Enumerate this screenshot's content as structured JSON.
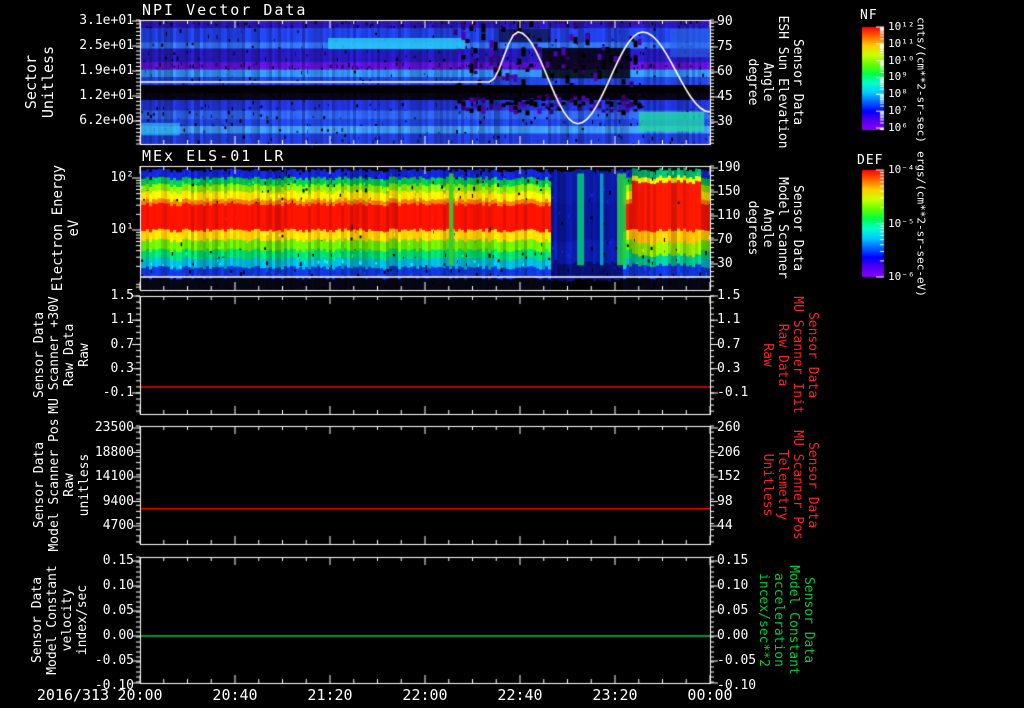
{
  "app": {
    "type": "science-multipanel-time-series-plot",
    "background": "#000000"
  },
  "chart_data": {
    "type": "multi-panel-timeseries",
    "x_axis": {
      "date_label": "2016/313",
      "tick_labels": [
        "20:00",
        "20:40",
        "21:20",
        "22:00",
        "22:40",
        "23:20",
        "00:00"
      ],
      "minor_divisions_per_major": 4
    },
    "panels": [
      {
        "id": "npi-vector-data",
        "plot_type": "spectrogram",
        "title": "NPI Vector Data",
        "left_label": "Sector\nUnitless",
        "left_ticks": [
          "3.1e+01",
          "2.5e+01",
          "1.9e+01",
          "1.2e+01",
          "6.2e+00"
        ],
        "right_label": "Sensor Data\nESH Sun Elevation\nAngle\ndegree",
        "right_label_color": "#ffffff",
        "right_ticks": [
          "90",
          "75",
          "60",
          "45",
          "30"
        ],
        "colorbar": "nf",
        "bands": [
          [
            0.0,
            0.065,
            "#2a14a8",
            0.5
          ],
          [
            0.065,
            0.18,
            "#1f3cd8",
            0.25
          ],
          [
            0.18,
            0.23,
            "#2f6ce8",
            0.15
          ],
          [
            0.23,
            0.34,
            "#2418b0",
            0.3
          ],
          [
            0.34,
            0.4,
            "#5a10c8",
            0.6
          ],
          [
            0.4,
            0.46,
            "#2f86e8",
            0.15
          ],
          [
            0.46,
            0.525,
            "#2040d0",
            0.2
          ],
          [
            0.525,
            0.59,
            "#000000",
            0.0
          ],
          [
            0.59,
            0.645,
            "#0a0418",
            0.55
          ],
          [
            0.645,
            0.73,
            "#1f30c8",
            0.35
          ],
          [
            0.73,
            0.8,
            "#2a5ce0",
            0.2
          ],
          [
            0.8,
            0.855,
            "#2040d8",
            0.2
          ],
          [
            0.855,
            0.915,
            "#3a8ae8",
            0.15
          ],
          [
            0.915,
            1.0,
            "#1f38cc",
            0.25
          ]
        ],
        "patches": [
          [
            0.33,
            0.57,
            0.145,
            0.235,
            "#27c8f8",
            0.85
          ],
          [
            0.0,
            0.07,
            0.83,
            0.93,
            "#30b8f4",
            0.7
          ],
          [
            0.93,
            1.0,
            0.07,
            0.3,
            "#2a66e8",
            0.6
          ],
          [
            0.875,
            0.99,
            0.74,
            0.9,
            "#22d8a8",
            0.8
          ],
          [
            0.705,
            0.86,
            0.225,
            0.47,
            "#05030a",
            0.85
          ],
          [
            0.63,
            0.72,
            0.07,
            0.18,
            "#0a0515",
            0.6
          ]
        ],
        "disturbance_x": [
          0.55,
          0.875
        ],
        "overlay_curve": {
          "name": "esh-sun-elevation-angle",
          "color": "#ffffff",
          "units": "degree",
          "points_xfrac_angle": [
            [
              0,
              54
            ],
            [
              0.613,
              54
            ],
            [
              0.663,
              84
            ],
            [
              0.768,
              29
            ],
            [
              0.882,
              84
            ],
            [
              1,
              36
            ]
          ]
        }
      },
      {
        "id": "mex-els-01-lr",
        "plot_type": "spectrogram",
        "title": "MEx ELS-01 LR",
        "left_label": "Electron Energy\neV",
        "left_ticks": [
          "10²",
          "10¹"
        ],
        "right_label": "Sensor Data\nModel Scanner\nAngle\ndegrees",
        "right_label_color": "#ffffff",
        "right_ticks": [
          "190",
          "150",
          "110",
          "70",
          "30"
        ],
        "colorbar": "def",
        "bands": [
          [
            0.0,
            0.035,
            "#000000",
            0.0
          ],
          [
            0.035,
            0.1,
            "#1222cc",
            0.5
          ],
          [
            0.1,
            0.155,
            "#00bb44",
            0.3
          ],
          [
            0.155,
            0.21,
            "#88dd00",
            0.2
          ],
          [
            0.21,
            0.275,
            "#ffdd00",
            0.15
          ],
          [
            0.275,
            0.31,
            "#ff7700",
            0.1
          ],
          [
            0.31,
            0.52,
            "#ff1200",
            0.05
          ],
          [
            0.52,
            0.6,
            "#ffcc00",
            0.1
          ],
          [
            0.6,
            0.68,
            "#66dd00",
            0.15
          ],
          [
            0.68,
            0.75,
            "#00cc66",
            0.2
          ],
          [
            0.75,
            0.82,
            "#00aacc",
            0.3
          ],
          [
            0.82,
            0.9,
            "#1133cc",
            0.5
          ],
          [
            0.9,
            1.0,
            "#060612",
            0.6
          ]
        ],
        "dist": {
          "x0": 0.716,
          "x1": 0.846,
          "bands": [
            [
              0.0,
              0.035,
              "#000000",
              0.0
            ],
            [
              0.035,
              0.3,
              "#0c1aa0",
              0.5
            ],
            [
              0.3,
              0.6,
              "#0a1698",
              0.55
            ],
            [
              0.6,
              0.78,
              "#0c1ca8",
              0.5
            ],
            [
              0.78,
              0.92,
              "#081070",
              0.6
            ],
            [
              0.92,
              1.0,
              "#000000",
              0.5
            ]
          ],
          "stripes": [
            [
              0.767,
              0.012,
              "#00c878"
            ],
            [
              0.807,
              0.006,
              "#00a8d0"
            ],
            [
              0.837,
              0.016,
              "#22cc44"
            ]
          ]
        },
        "blob": {
          "x0": 0.858,
          "x1": 0.982,
          "bands": [
            [
              0.0,
              0.03,
              "#000000",
              0.0
            ],
            [
              0.03,
              0.09,
              "#00aa66",
              0.4
            ],
            [
              0.09,
              0.13,
              "#ffee00",
              0.15
            ],
            [
              0.13,
              0.52,
              "#ff1800",
              0.05
            ],
            [
              0.52,
              0.62,
              "#ffbb00",
              0.1
            ],
            [
              0.62,
              0.72,
              "#88dd00",
              0.15
            ],
            [
              0.72,
              0.8,
              "#00bb88",
              0.25
            ],
            [
              0.8,
              0.9,
              "#1133cc",
              0.5
            ],
            [
              0.9,
              1.0,
              "#060612",
              0.6
            ]
          ]
        },
        "seams": [
          [
            0.542,
            0.008,
            "#33cc33"
          ]
        ],
        "white_line_yfrac": 0.895
      },
      {
        "id": "mu-scanner-plus30v",
        "plot_type": "line",
        "left_label": "Sensor Data\nMU Scanner +30V\nRaw Data\nRaw",
        "left_ticks": [
          "1.5",
          "1.1",
          "0.7",
          "0.3",
          "-0.1"
        ],
        "right_label": "Sensor Data\nMU Scanner Init\nRaw Data\nRaw",
        "right_label_color": "#ff2020",
        "right_ticks": [
          "1.5",
          "1.1",
          "0.7",
          "0.3",
          "-0.1"
        ],
        "line": {
          "color": "#ff0000",
          "constant_value": 0.0
        }
      },
      {
        "id": "model-scanner-pos",
        "plot_type": "line",
        "left_label": "Sensor Data\nModel Scanner Pos\nRaw\nunitless",
        "left_ticks": [
          "23500",
          "18800",
          "14100",
          "9400",
          "4700"
        ],
        "right_label": "Sensor Data\nMU Scanner Pos\nTelemetry\nUnitless",
        "right_label_color": "#ff2020",
        "right_ticks": [
          "260",
          "206",
          "152",
          "98",
          "44"
        ],
        "line": {
          "color": "#ff0000",
          "constant_value": 8000
        }
      },
      {
        "id": "model-constant-velocity",
        "plot_type": "line",
        "left_label": "Sensor Data\nModel Constant\nvelocity\nindex/sec",
        "left_ticks": [
          "0.15",
          "0.10",
          "0.05",
          "0.00",
          "-0.05",
          "-0.10"
        ],
        "right_label": "Sensor Data\nModel Constant\nacceleration\nincex/sec**2",
        "right_label_color": "#00cc33",
        "right_ticks": [
          "0.15",
          "0.10",
          "0.05",
          "0.00",
          "-0.05",
          "-0.10"
        ],
        "line": {
          "color": "#00cc33",
          "constant_value": 0.0
        }
      }
    ],
    "colorbars": [
      {
        "id": "nf",
        "title": "NF",
        "tick_labels": [
          "10¹²",
          "10¹¹",
          "10¹⁰",
          "10⁹",
          "10⁸",
          "10⁷",
          "10⁶"
        ],
        "units": "cnts/(cm**2-sr-sec)",
        "colors_top_to_bottom": [
          "#ff0000",
          "#ff6600",
          "#ffcc00",
          "#ccff00",
          "#66ff00",
          "#00ff44",
          "#00ffcc",
          "#00ccff",
          "#0066ff",
          "#0000ff",
          "#5500ee",
          "#8800ff"
        ]
      },
      {
        "id": "def",
        "title": "DEF",
        "tick_labels": [
          "10⁻⁴",
          "10⁻⁵",
          "10⁻⁶"
        ],
        "units": "ergs/(cm**2-sr-sec-eV)",
        "colors_top_to_bottom": [
          "#ff0000",
          "#ff6600",
          "#ffcc00",
          "#ccff00",
          "#66ff00",
          "#00ff44",
          "#00ffcc",
          "#00ccff",
          "#0066ff",
          "#0000ff",
          "#5500ee",
          "#8800ff"
        ]
      }
    ]
  }
}
